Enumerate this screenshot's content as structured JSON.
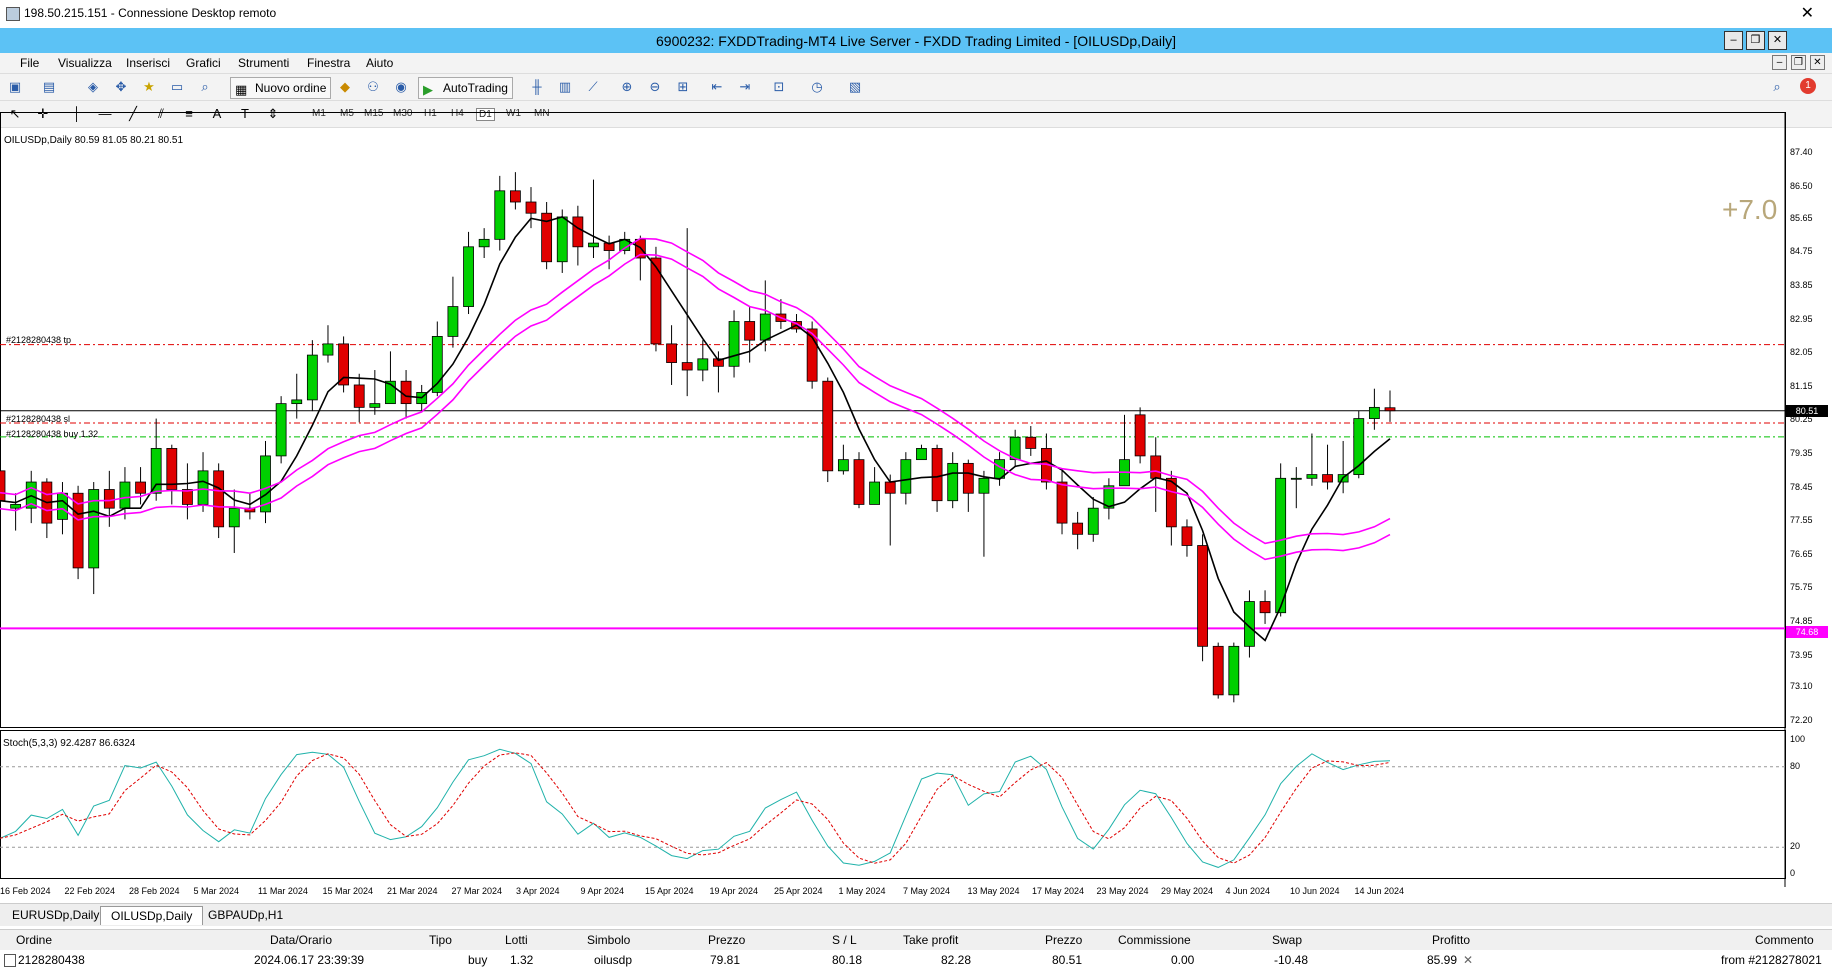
{
  "rdp": {
    "title": "198.50.215.151 - Connessione Desktop remoto",
    "close": "✕"
  },
  "window": {
    "title": "6900232: FXDDTrading-MT4 Live Server - FXDD Trading Limited - [OILUSDp,Daily]"
  },
  "menu": [
    "File",
    "Visualizza",
    "Inserisci",
    "Grafici",
    "Strumenti",
    "Finestra",
    "Aiuto"
  ],
  "toolbar": {
    "new_order": "Nuovo ordine",
    "autotrading": "AutoTrading",
    "notifications": "1"
  },
  "timeframes": [
    "M1",
    "M5",
    "M15",
    "M30",
    "H1",
    "H4",
    "D1",
    "W1",
    "MN"
  ],
  "chart": {
    "symbol_info": "OILUSDp,Daily  80.59 81.05 80.21 80.51",
    "profit_overlay": "+7.0",
    "stoch_label": "Stoch(5,3,3) 92.4287 86.6324",
    "lines": {
      "tp": "#2128280438 tp",
      "sl": "#2128280438 sl",
      "buy": "#2128280438 buy 1.32"
    },
    "current_price": "80.51",
    "alert_level": "74.68",
    "price_axis": [
      "87.40",
      "86.50",
      "85.65",
      "84.75",
      "83.85",
      "82.95",
      "82.05",
      "81.15",
      "80.25",
      "79.35",
      "78.45",
      "77.55",
      "76.65",
      "75.75",
      "74.85",
      "73.95",
      "73.10",
      "72.20"
    ],
    "stoch_axis": [
      "100",
      "80",
      "20",
      "0"
    ],
    "dates": [
      "16 Feb 2024",
      "22 Feb 2024",
      "28 Feb 2024",
      "5 Mar 2024",
      "11 Mar 2024",
      "15 Mar 2024",
      "21 Mar 2024",
      "27 Mar 2024",
      "3 Apr 2024",
      "9 Apr 2024",
      "15 Apr 2024",
      "19 Apr 2024",
      "25 Apr 2024",
      "1 May 2024",
      "7 May 2024",
      "13 May 2024",
      "17 May 2024",
      "23 May 2024",
      "29 May 2024",
      "4 Jun 2024",
      "10 Jun 2024",
      "14 Jun 2024"
    ]
  },
  "chart_data": {
    "type": "candlestick",
    "ylim": [
      72.2,
      87.6
    ],
    "levels": {
      "tp": 82.28,
      "sl": 80.18,
      "buy": 79.81,
      "alert": 74.68,
      "current": 80.51
    },
    "candles": [
      [
        78.9,
        78.1,
        79.2,
        77.7
      ],
      [
        77.9,
        78.0,
        78.3,
        77.3
      ],
      [
        77.9,
        78.6,
        78.9,
        77.5
      ],
      [
        78.6,
        77.5,
        78.7,
        77.1
      ],
      [
        77.6,
        78.3,
        78.6,
        77.2
      ],
      [
        78.3,
        76.3,
        78.5,
        76.0
      ],
      [
        76.3,
        78.4,
        78.6,
        75.6
      ],
      [
        78.4,
        77.9,
        78.9,
        77.4
      ],
      [
        77.9,
        78.6,
        79.0,
        77.6
      ],
      [
        78.6,
        78.3,
        79.0,
        78.0
      ],
      [
        78.3,
        79.5,
        80.3,
        78.1
      ],
      [
        79.5,
        78.4,
        79.6,
        78.0
      ],
      [
        78.4,
        78.0,
        79.1,
        77.6
      ],
      [
        78.0,
        78.9,
        79.4,
        77.8
      ],
      [
        78.9,
        77.4,
        79.1,
        77.1
      ],
      [
        77.4,
        77.9,
        78.4,
        76.7
      ],
      [
        77.9,
        77.8,
        78.3,
        77.6
      ],
      [
        77.8,
        79.3,
        79.7,
        77.5
      ],
      [
        79.3,
        80.7,
        80.9,
        79.1
      ],
      [
        80.7,
        80.8,
        81.5,
        80.3
      ],
      [
        80.8,
        82.0,
        82.4,
        80.5
      ],
      [
        82.0,
        82.3,
        82.8,
        81.8
      ],
      [
        82.3,
        81.2,
        82.5,
        81.0
      ],
      [
        81.2,
        80.6,
        81.5,
        80.2
      ],
      [
        80.6,
        80.7,
        81.6,
        80.4
      ],
      [
        80.7,
        81.3,
        82.1,
        80.8
      ],
      [
        81.3,
        80.7,
        81.6,
        80.3
      ],
      [
        80.7,
        81.0,
        81.2,
        80.5
      ],
      [
        81.0,
        82.5,
        82.9,
        80.9
      ],
      [
        82.5,
        83.3,
        84.1,
        82.2
      ],
      [
        83.3,
        84.9,
        85.3,
        83.1
      ],
      [
        84.9,
        85.1,
        85.4,
        84.6
      ],
      [
        85.1,
        86.4,
        86.8,
        84.8
      ],
      [
        86.4,
        86.1,
        86.9,
        85.9
      ],
      [
        86.1,
        85.8,
        86.5,
        85.4
      ],
      [
        85.8,
        84.5,
        86.1,
        84.3
      ],
      [
        84.5,
        85.7,
        85.9,
        84.2
      ],
      [
        85.7,
        84.9,
        86.0,
        84.4
      ],
      [
        84.9,
        85.0,
        86.7,
        84.6
      ],
      [
        85.0,
        84.8,
        85.2,
        84.3
      ],
      [
        84.8,
        85.1,
        85.3,
        84.7
      ],
      [
        85.1,
        84.6,
        85.2,
        84.0
      ],
      [
        84.6,
        82.3,
        84.9,
        82.1
      ],
      [
        82.3,
        81.8,
        82.8,
        81.2
      ],
      [
        81.8,
        81.6,
        85.4,
        80.9
      ],
      [
        81.6,
        81.9,
        82.4,
        81.3
      ],
      [
        81.9,
        81.7,
        82.1,
        81.0
      ],
      [
        81.7,
        82.9,
        83.2,
        81.4
      ],
      [
        82.9,
        82.4,
        83.3,
        81.8
      ],
      [
        82.4,
        83.1,
        84.0,
        82.1
      ],
      [
        83.1,
        82.9,
        83.5,
        82.7
      ],
      [
        82.9,
        82.7,
        83.1,
        82.6
      ],
      [
        82.7,
        81.3,
        82.9,
        81.1
      ],
      [
        81.3,
        78.9,
        81.4,
        78.6
      ],
      [
        78.9,
        79.2,
        79.6,
        78.8
      ],
      [
        79.2,
        78.0,
        79.4,
        77.9
      ],
      [
        78.0,
        78.6,
        79.0,
        78.0
      ],
      [
        78.6,
        78.3,
        78.8,
        76.9
      ],
      [
        78.3,
        79.2,
        79.4,
        78.0
      ],
      [
        79.2,
        79.5,
        79.6,
        79.3
      ],
      [
        79.5,
        78.1,
        79.6,
        77.8
      ],
      [
        78.1,
        79.1,
        79.4,
        77.9
      ],
      [
        79.1,
        78.3,
        79.2,
        77.8
      ],
      [
        78.3,
        78.7,
        78.9,
        76.6
      ],
      [
        78.7,
        79.2,
        79.4,
        78.5
      ],
      [
        79.2,
        79.8,
        80.0,
        79.0
      ],
      [
        79.8,
        79.5,
        80.1,
        79.3
      ],
      [
        79.5,
        78.6,
        79.9,
        78.4
      ],
      [
        78.6,
        77.5,
        78.9,
        77.2
      ],
      [
        77.5,
        77.2,
        77.8,
        76.8
      ],
      [
        77.2,
        77.9,
        78.2,
        77.0
      ],
      [
        77.9,
        78.5,
        78.7,
        77.6
      ],
      [
        78.5,
        79.2,
        80.4,
        79.0
      ],
      [
        80.4,
        79.3,
        80.6,
        79.1
      ],
      [
        79.3,
        78.7,
        79.8,
        77.8
      ],
      [
        78.7,
        77.4,
        78.9,
        76.9
      ],
      [
        77.4,
        76.9,
        77.6,
        76.6
      ],
      [
        76.9,
        74.2,
        77.2,
        73.8
      ],
      [
        74.2,
        72.9,
        74.3,
        72.8
      ],
      [
        72.9,
        74.2,
        74.3,
        72.7
      ],
      [
        74.2,
        75.4,
        75.7,
        73.9
      ],
      [
        75.4,
        75.1,
        75.7,
        74.8
      ],
      [
        75.1,
        78.7,
        79.1,
        75.0
      ],
      [
        78.7,
        78.7,
        79.0,
        77.9
      ],
      [
        78.7,
        78.8,
        79.9,
        78.5
      ],
      [
        78.8,
        78.6,
        79.6,
        78.4
      ],
      [
        78.6,
        78.8,
        79.7,
        78.3
      ],
      [
        78.8,
        80.3,
        80.5,
        78.7
      ],
      [
        80.3,
        80.6,
        81.1,
        80.0
      ],
      [
        80.59,
        80.51,
        81.05,
        80.21
      ]
    ]
  },
  "tabs": [
    "EURUSDp,Daily",
    "OILUSDp,Daily",
    "GBPAUDp,H1"
  ],
  "terminal": {
    "headers": {
      "order": "Ordine",
      "time": "Data/Orario",
      "type": "Tipo",
      "lots": "Lotti",
      "symbol": "Simbolo",
      "price": "Prezzo",
      "sl": "S / L",
      "tp": "Take profit",
      "price2": "Prezzo",
      "commission": "Commissione",
      "swap": "Swap",
      "profit": "Profitto",
      "comment": "Commento"
    },
    "row": {
      "order": "2128280438",
      "time": "2024.06.17 23:39:39",
      "type": "buy",
      "lots": "1.32",
      "symbol": "oilusdp",
      "price": "79.81",
      "sl": "80.18",
      "tp": "82.28",
      "price2": "80.51",
      "commission": "0.00",
      "swap": "-10.48",
      "profit": "85.99",
      "close": "✕",
      "comment": "from #2128278021"
    }
  },
  "colors": {
    "bull": "#00d000",
    "bear": "#e00000",
    "ma_fast": "#000000",
    "ma_band": "#ff00ff",
    "stoch_main": "#20b2aa",
    "stoch_signal": "#e00000",
    "title_bar": "#5cc2f5"
  }
}
